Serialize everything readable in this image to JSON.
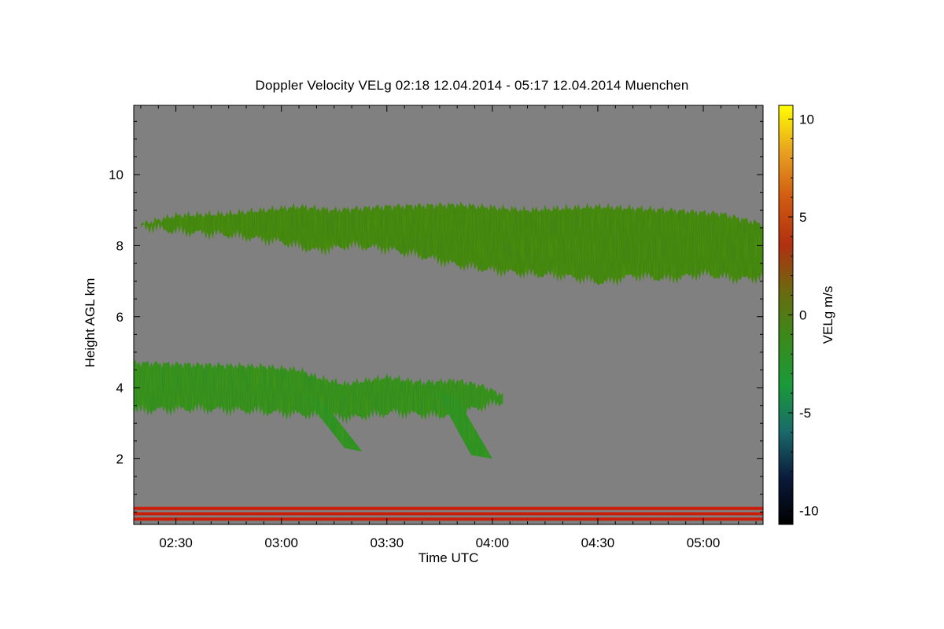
{
  "title": "Doppler Velocity VELg   02:18 12.04.2014 - 05:17 12.04.2014 Muenchen",
  "chart_data": {
    "type": "heatmap",
    "title": "Doppler Velocity VELg   02:18 12.04.2014 - 05:17 12.04.2014 Muenchen",
    "xlabel": "Time UTC",
    "ylabel": "Height AGL km",
    "xlim_minutes_utc": [
      138,
      317
    ],
    "ylim_km": [
      0.15,
      11.95
    ],
    "x_ticks": [
      {
        "label": "02:30",
        "minutes": 150
      },
      {
        "label": "03:00",
        "minutes": 180
      },
      {
        "label": "03:30",
        "minutes": 210
      },
      {
        "label": "04:00",
        "minutes": 240
      },
      {
        "label": "04:30",
        "minutes": 270
      },
      {
        "label": "05:00",
        "minutes": 300
      }
    ],
    "y_ticks": [
      {
        "label": "2",
        "value": 2
      },
      {
        "label": "4",
        "value": 4
      },
      {
        "label": "6",
        "value": 6
      },
      {
        "label": "8",
        "value": 8
      },
      {
        "label": "10",
        "value": 10
      }
    ],
    "background_color": "#808080",
    "colorbar": {
      "label": "VELg m/s",
      "range": [
        -10.7,
        10.7
      ],
      "ticks": [
        {
          "label": "10",
          "value": 10
        },
        {
          "label": "5",
          "value": 5
        },
        {
          "label": "0",
          "value": 0
        },
        {
          "label": "-5",
          "value": -5
        },
        {
          "label": "-10",
          "value": -10
        }
      ],
      "colors": [
        "#000000",
        "#0a1a3a",
        "#1a6a6a",
        "#1a9a3a",
        "#3a8a1a",
        "#6a6a10",
        "#b03010",
        "#d05a10",
        "#e8a020",
        "#ffff00"
      ]
    },
    "regions": [
      {
        "name": "upper cloud layer",
        "velocity_mps": -0.8,
        "time_min": [
          140,
          317
        ],
        "top_km": [
          [
            140,
            8.6
          ],
          [
            150,
            8.85
          ],
          [
            165,
            8.9
          ],
          [
            185,
            9.1
          ],
          [
            195,
            9.0
          ],
          [
            210,
            9.1
          ],
          [
            230,
            9.15
          ],
          [
            250,
            9.0
          ],
          [
            270,
            9.1
          ],
          [
            290,
            9.0
          ],
          [
            305,
            8.9
          ],
          [
            317,
            8.6
          ]
        ],
        "base_km": [
          [
            140,
            8.55
          ],
          [
            150,
            8.4
          ],
          [
            165,
            8.3
          ],
          [
            180,
            8.1
          ],
          [
            190,
            7.85
          ],
          [
            200,
            8.0
          ],
          [
            210,
            7.9
          ],
          [
            220,
            7.7
          ],
          [
            230,
            7.45
          ],
          [
            240,
            7.3
          ],
          [
            250,
            7.2
          ],
          [
            260,
            7.15
          ],
          [
            272,
            6.95
          ],
          [
            280,
            7.15
          ],
          [
            290,
            7.05
          ],
          [
            300,
            7.2
          ],
          [
            310,
            7.05
          ],
          [
            317,
            7.1
          ]
        ]
      },
      {
        "name": "lower cloud layer",
        "velocity_mps": -1.8,
        "time_min": [
          138,
          243
        ],
        "top_km": [
          [
            138,
            4.7
          ],
          [
            155,
            4.65
          ],
          [
            175,
            4.6
          ],
          [
            185,
            4.5
          ],
          [
            190,
            4.3
          ],
          [
            198,
            4.1
          ],
          [
            210,
            4.3
          ],
          [
            220,
            4.15
          ],
          [
            230,
            4.2
          ],
          [
            237,
            4.05
          ],
          [
            243,
            3.8
          ]
        ],
        "base_km": [
          [
            138,
            3.35
          ],
          [
            155,
            3.4
          ],
          [
            170,
            3.35
          ],
          [
            185,
            3.25
          ],
          [
            200,
            3.15
          ],
          [
            212,
            3.3
          ],
          [
            225,
            3.2
          ],
          [
            235,
            3.4
          ],
          [
            243,
            3.6
          ]
        ]
      },
      {
        "name": "precipitation streak",
        "velocity_mps": -2.2,
        "top_km": [
          [
            186,
            3.8
          ],
          [
            192,
            3.6
          ]
        ],
        "base_km": [
          [
            198,
            2.3
          ],
          [
            203,
            2.2
          ]
        ]
      },
      {
        "name": "precipitation streak",
        "velocity_mps": -2.2,
        "top_km": [
          [
            224,
            3.9
          ],
          [
            230,
            3.7
          ]
        ],
        "base_km": [
          [
            234,
            2.1
          ],
          [
            240,
            2.0
          ]
        ]
      },
      {
        "name": "surface clutter rows",
        "velocity_mps": 1.2,
        "heights_km": [
          0.3,
          0.45,
          0.6
        ]
      }
    ]
  }
}
